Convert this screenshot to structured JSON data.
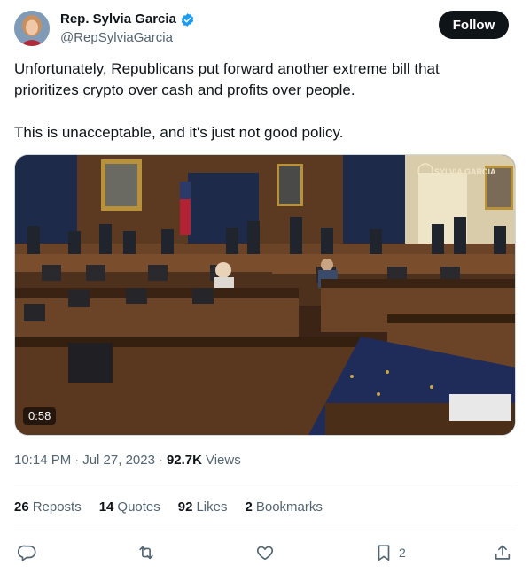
{
  "author": {
    "display_name": "Rep. Sylvia Garcia",
    "handle": "@RepSylviaGarcia",
    "verified_icon": "verified-badge-icon",
    "follow_label": "Follow"
  },
  "tweet": {
    "paragraph_1": "Unfortunately, Republicans put forward another extreme bill that prioritizes crypto over cash and profits over people.",
    "paragraph_2": "This is unacceptable, and it's just not good policy."
  },
  "media": {
    "duration": "0:58",
    "watermark": "SYLVIA GARCIA"
  },
  "meta": {
    "time": "10:14 PM",
    "separator": "·",
    "date": "Jul 27, 2023",
    "views_count": "92.7K",
    "views_label": "Views"
  },
  "stats": {
    "reposts_count": "26",
    "reposts_label": "Reposts",
    "quotes_count": "14",
    "quotes_label": "Quotes",
    "likes_count": "92",
    "likes_label": "Likes",
    "bookmarks_count": "2",
    "bookmarks_label": "Bookmarks"
  },
  "actions": {
    "reply_icon": "reply-icon",
    "repost_icon": "repost-icon",
    "like_icon": "heart-icon",
    "bookmark_icon": "bookmark-icon",
    "bookmark_count": "2",
    "share_icon": "share-icon"
  },
  "colors": {
    "text_primary": "#0f1419",
    "text_secondary": "#536471",
    "verified_blue": "#1d9bf0",
    "divider": "#eff3f4",
    "follow_bg": "#0f1419"
  }
}
